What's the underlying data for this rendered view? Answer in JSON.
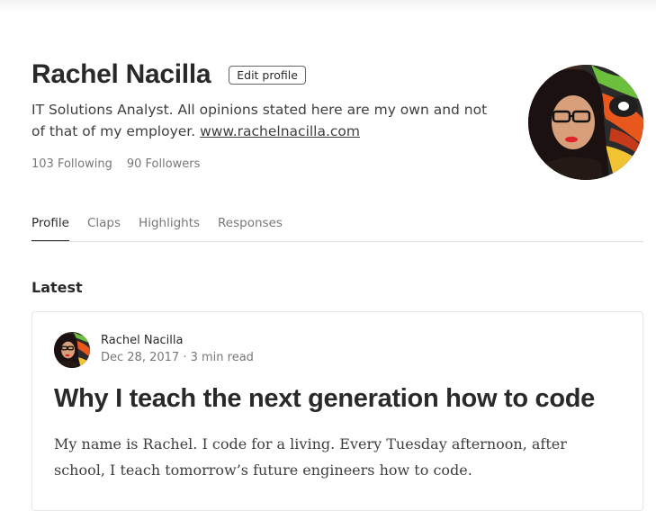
{
  "profile": {
    "name": "Rachel Nacilla",
    "edit_label": "Edit profile",
    "bio_text": "IT Solutions Analyst. All opinions stated here are my own and not of that of my employer. ",
    "bio_link": "www.rachelnacilla.com",
    "following": "103 Following",
    "followers": "90 Followers"
  },
  "tabs": [
    {
      "label": "Profile",
      "active": true
    },
    {
      "label": "Claps",
      "active": false
    },
    {
      "label": "Highlights",
      "active": false
    },
    {
      "label": "Responses",
      "active": false
    }
  ],
  "latest": {
    "heading": "Latest",
    "post": {
      "author": "Rachel Nacilla",
      "date": "Dec 28, 2017",
      "separator": " · ",
      "read_time": "3 min read",
      "title": "Why I teach the next generation how to code",
      "excerpt": "My name is Rachel. I code for a living. Every Tuesday afternoon, after school, I teach tomorrow’s future engineers how to code."
    }
  },
  "colors": {
    "text_primary": "rgba(0,0,0,0.84)",
    "text_muted": "rgba(0,0,0,0.54)",
    "lipstick": "#e0242c",
    "mural_green": "#6cbf3c",
    "mural_orange": "#e8581c"
  }
}
